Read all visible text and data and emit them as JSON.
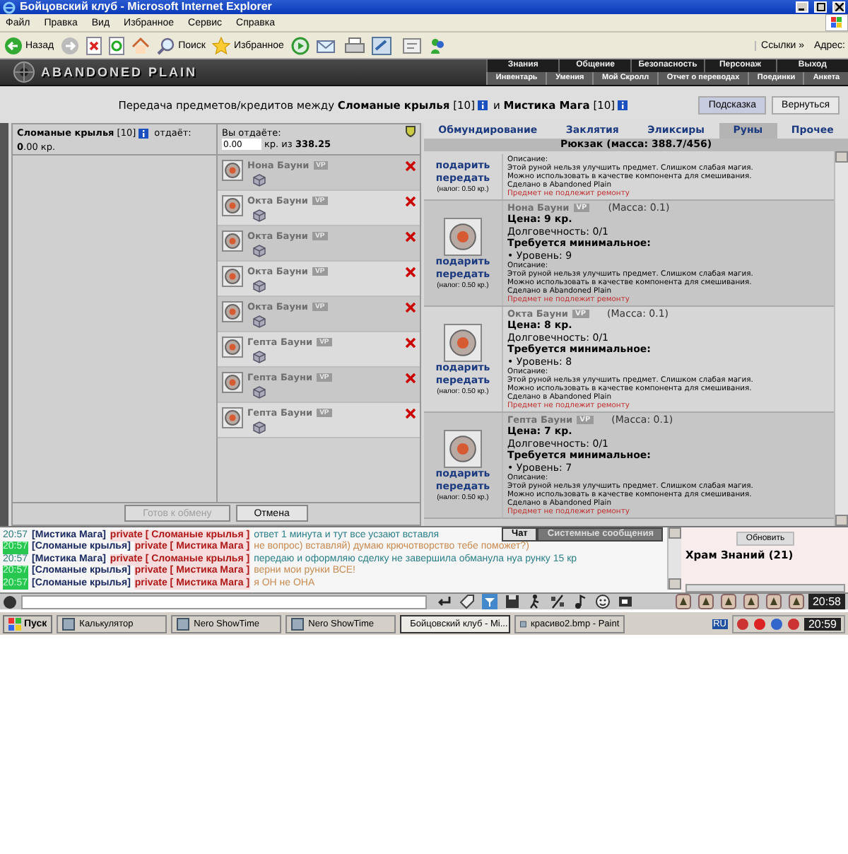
{
  "window": {
    "title": "Бойцовский клуб - Microsoft Internet Explorer"
  },
  "menu": [
    "Файл",
    "Правка",
    "Вид",
    "Избранное",
    "Сервис",
    "Справка"
  ],
  "toolbar": {
    "back": "Назад",
    "search": "Поиск",
    "favorites": "Избранное",
    "links": "Ссылки",
    "links_more": "»",
    "address": "Адрес:"
  },
  "game": {
    "logo": "ABANDONED PLAIN",
    "nav_top": [
      "Знания",
      "Общение",
      "Безопасность",
      "Персонаж",
      "Выход"
    ],
    "nav_bottom": [
      "Инвентарь",
      "Умения",
      "Мой Скролл",
      "Отчет о переводах",
      "Поединки",
      "Анкета"
    ]
  },
  "transfer": {
    "title_a": "Передача предметов/кредитов между **Сломаные крылья** [10]",
    "title_b": "и **Мистика Мага** [10]",
    "buttons": [
      {
        "label": "Подсказка",
        "selected": true
      },
      {
        "label": "Вернуться",
        "selected": false
      }
    ]
  },
  "partner": {
    "name": "**Сломаные крылья** [10]",
    "gives": "отдаёт:",
    "amount": "**0**.00 кр."
  },
  "mine": {
    "label": "Вы отдаёте:",
    "value": "0.00",
    "of": "кр. из **338.25**",
    "items": [
      {
        "name": "Нона Бауни",
        "badge": "VP"
      },
      {
        "name": "Окта Бауни",
        "badge": "VP"
      },
      {
        "name": "Окта Бауни",
        "badge": "VP"
      },
      {
        "name": "Окта Бауни",
        "badge": "VP"
      },
      {
        "name": "Окта Бауни",
        "badge": "VP"
      },
      {
        "name": "Гепта Бауни",
        "badge": "VP"
      },
      {
        "name": "Гепта Бауни",
        "badge": "VP"
      },
      {
        "name": "Гепта Бауни",
        "badge": "VP"
      }
    ]
  },
  "actions": [
    {
      "label": "Готов к обмену",
      "disabled": true
    },
    {
      "label": "Отмена",
      "disabled": false
    }
  ],
  "inventory": {
    "tabs": [
      {
        "label": "Обмундирование",
        "selected": false
      },
      {
        "label": "Заклятия",
        "selected": false
      },
      {
        "label": "Эликсиры",
        "selected": false
      },
      {
        "label": "Руны",
        "selected": true
      },
      {
        "label": "Прочее",
        "selected": false
      }
    ],
    "title": "Рюкзак (масса: 388.7/456)",
    "items": [
      {
        "kind": "partial",
        "actions": [
          "подарить",
          "передать"
        ],
        "tax": "(налог: 0.50 кр.)",
        "desc_label": "Описание:",
        "desc": [
          "Этой руной нельзя улучшить предмет. Слишком слабая магия.",
          "Можно использовать в качестве компонента для смешивания.",
          "Сделано в Abandoned Plain"
        ],
        "note": "Предмет не подлежит ремонту"
      },
      {
        "kind": "full",
        "name": "Нона Бауни",
        "badge": "VP",
        "mass": "(Масса: 0.1)",
        "price": "Цена: 9 кр.",
        "durability": "Долговечность: 0/1",
        "req": "Требуется минимальное:",
        "level": "• Уровень: 9",
        "actions": [
          "подарить",
          "передать"
        ],
        "tax": "(налог: 0.50 кр.)",
        "desc_label": "Описание:",
        "desc": [
          "Этой руной нельзя улучшить предмет. Слишком слабая магия.",
          "Можно использовать в качестве компонента для смешивания.",
          "Сделано в Abandoned Plain"
        ],
        "note": "Предмет не подлежит ремонту"
      },
      {
        "kind": "full",
        "name": "Окта Бауни",
        "badge": "VP",
        "mass": "(Масса: 0.1)",
        "price": "Цена: 8 кр.",
        "durability": "Долговечность: 0/1",
        "req": "Требуется минимальное:",
        "level": "• Уровень: 8",
        "actions": [
          "подарить",
          "передать"
        ],
        "tax": "(налог: 0.50 кр.)",
        "desc_label": "Описание:",
        "desc": [
          "Этой руной нельзя улучшить предмет. Слишком слабая магия.",
          "Можно использовать в качестве компонента для смешивания.",
          "Сделано в Abandoned Plain"
        ],
        "note": "Предмет не подлежит ремонту"
      },
      {
        "kind": "full",
        "name": "Гепта Бауни",
        "badge": "VP",
        "mass": "(Масса: 0.1)",
        "price": "Цена: 7 кр.",
        "durability": "Долговечность: 0/1",
        "req": "Требуется минимальное:",
        "level": "• Уровень: 7",
        "actions": [
          "подарить",
          "передать"
        ],
        "tax": "(налог: 0.50 кр.)",
        "desc_label": "Описание:",
        "desc": [
          "Этой руной нельзя улучшить предмет. Слишком слабая магия.",
          "Можно использовать в качестве компонента для смешивания.",
          "Сделано в Abandoned Plain"
        ],
        "note": "Предмет не подлежит ремонту"
      }
    ]
  },
  "chat": {
    "tabs": [
      {
        "label": "Чат",
        "selected": true
      },
      {
        "label": "Системные сообщения",
        "selected": false
      }
    ],
    "messages": [
      {
        "time": "20:57",
        "own": false,
        "from": "[Мистика Мага]",
        "private": "private [ Сломаные крылья ]",
        "text": "ответ 1 минута и тут все усзают вставля"
      },
      {
        "time": "20:57",
        "own": true,
        "from": "[Сломаные крылья]",
        "private": "private [ Мистика Мага ]",
        "text": "не вопрос) вставляй) думаю крючотворство тебе поможет?)"
      },
      {
        "time": "20:57",
        "own": false,
        "from": "[Мистика Мага]",
        "private": "private [ Сломаные крылья ]",
        "text": "передаю и оформляю сделку не завершила обманула нуа рунку 15 кр"
      },
      {
        "time": "20:57",
        "own": true,
        "from": "[Сломаные крылья]",
        "private": "private [ Мистика Мага ]",
        "text": "верни мои рунки ВСЕ!"
      },
      {
        "time": "20:57",
        "own": true,
        "from": "[Сломаные крылья]",
        "private": "private [ Мистика Мага ]",
        "text": "я ОН не ОНА"
      }
    ],
    "refresh": "Обновить",
    "room": "Храм Знаний (21)"
  },
  "input_bar": {
    "clock": "20:58"
  },
  "taskbar": {
    "start": "Пуск",
    "tasks": [
      {
        "label": "Калькулятор",
        "selected": false
      },
      {
        "label": "Nero ShowTime",
        "selected": false
      },
      {
        "label": "Nero ShowTime",
        "selected": false
      },
      {
        "label": "Бойцовский клуб - Mi...",
        "selected": true
      },
      {
        "label": "красиво2.bmp - Paint",
        "selected": false
      }
    ],
    "lang": "RU",
    "clock": "20:59"
  }
}
